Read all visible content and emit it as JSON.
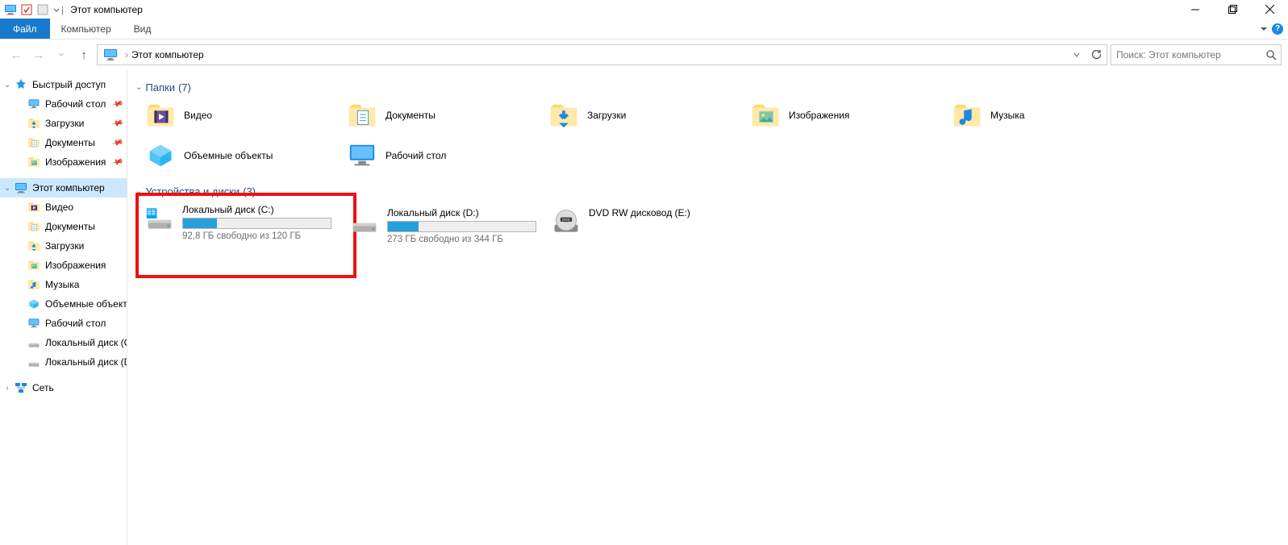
{
  "window": {
    "title": "Этот компьютер",
    "sep": "|"
  },
  "ribbon": {
    "file": "Файл",
    "tabs": [
      "Компьютер",
      "Вид"
    ]
  },
  "address": {
    "crumb": "Этот компьютер",
    "sep": "›"
  },
  "search": {
    "placeholder": "Поиск: Этот компьютер"
  },
  "tree": {
    "quick": {
      "label": "Быстрый доступ",
      "items": [
        {
          "label": "Рабочий стол",
          "pin": true,
          "icon": "desktop"
        },
        {
          "label": "Загрузки",
          "pin": true,
          "icon": "downloads"
        },
        {
          "label": "Документы",
          "pin": true,
          "icon": "documents"
        },
        {
          "label": "Изображения",
          "pin": true,
          "icon": "pictures"
        }
      ]
    },
    "thispc": {
      "label": "Этот компьютер",
      "items": [
        {
          "label": "Видео",
          "icon": "videos"
        },
        {
          "label": "Документы",
          "icon": "documents"
        },
        {
          "label": "Загрузки",
          "icon": "downloads"
        },
        {
          "label": "Изображения",
          "icon": "pictures"
        },
        {
          "label": "Музыка",
          "icon": "music"
        },
        {
          "label": "Объемные объекты",
          "icon": "objects3d"
        },
        {
          "label": "Рабочий стол",
          "icon": "desktop"
        },
        {
          "label": "Локальный диск (C",
          "icon": "drive"
        },
        {
          "label": "Локальный диск (D",
          "icon": "drive"
        }
      ]
    },
    "network": {
      "label": "Сеть"
    }
  },
  "groups": {
    "folders": {
      "title": "Папки",
      "count": "(7)",
      "items": [
        {
          "label": "Видео",
          "icon": "videos"
        },
        {
          "label": "Документы",
          "icon": "documents"
        },
        {
          "label": "Загрузки",
          "icon": "downloads"
        },
        {
          "label": "Изображения",
          "icon": "pictures"
        },
        {
          "label": "Музыка",
          "icon": "music"
        },
        {
          "label": "Объемные объекты",
          "icon": "objects3d"
        },
        {
          "label": "Рабочий стол",
          "icon": "desktop"
        }
      ]
    },
    "drives": {
      "title": "Устройства и диски",
      "count": "(3)",
      "items": [
        {
          "label": "Локальный диск (C:)",
          "sub": "92,8 ГБ свободно из 120 ГБ",
          "fill": 23,
          "icon": "drive-c",
          "highlight": true
        },
        {
          "label": "Локальный диск (D:)",
          "sub": "273 ГБ свободно из 344 ГБ",
          "fill": 21,
          "icon": "drive",
          "highlight": false
        },
        {
          "label": "DVD RW дисковод (E:)",
          "sub": "",
          "fill": -1,
          "icon": "dvd",
          "highlight": false
        }
      ]
    }
  }
}
